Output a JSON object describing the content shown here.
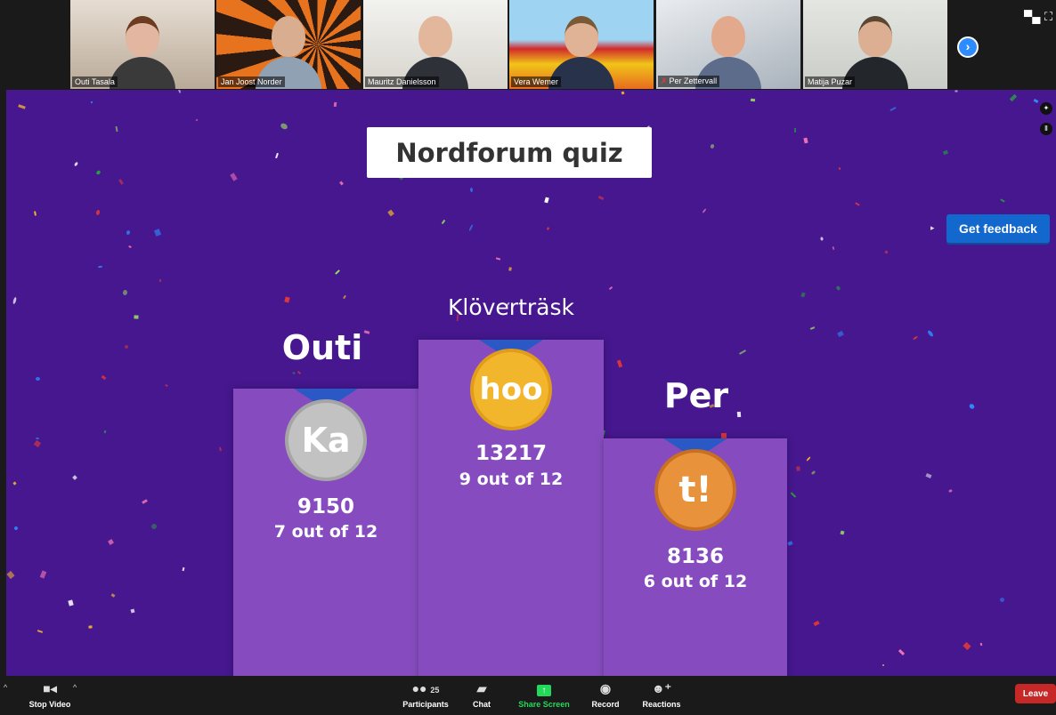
{
  "participants": [
    {
      "name": "Outi Tasala"
    },
    {
      "name": "Jan Joost Norder"
    },
    {
      "name": "Mauritz Danielsson"
    },
    {
      "name": "Vera Wemer"
    },
    {
      "name": "Per Zettervall"
    },
    {
      "name": "Matija Puzar"
    }
  ],
  "quiz": {
    "title": "Nordforum quiz",
    "feedback_label": "Get feedback",
    "podium": [
      {
        "place": 2,
        "name": "Outi",
        "medal_text": "Ka",
        "score": "9150",
        "correct": "7 out of 12",
        "medal_color": "#c2c2c2"
      },
      {
        "place": 1,
        "name": "Klöverträsk",
        "medal_text": "hoo",
        "score": "13217",
        "correct": "9 out of 12",
        "medal_color": "#f2b62c"
      },
      {
        "place": 3,
        "name": "Per",
        "medal_text": "t!",
        "score": "8136",
        "correct": "6 out of 12",
        "medal_color": "#e8923c"
      }
    ]
  },
  "toolbar": {
    "stop_video": "Stop Video",
    "participants": "Participants",
    "participants_count": "25",
    "chat": "Chat",
    "share_screen": "Share Screen",
    "record": "Record",
    "reactions": "Reactions",
    "leave": "Leave"
  },
  "colors": {
    "stage_bg": "#46178f",
    "podium": "#864cbf",
    "accent_blue": "#1368ce",
    "share_green": "#23d959",
    "leave_red": "#c62828"
  }
}
